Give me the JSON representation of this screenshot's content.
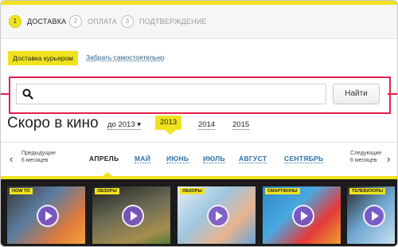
{
  "steps": [
    {
      "num": "1",
      "label": "ДОСТАВКА"
    },
    {
      "num": "2",
      "label": "ОПЛАТА"
    },
    {
      "num": "3",
      "label": "ПОДТВЕРЖДЕНИЕ"
    }
  ],
  "delivery": {
    "courier": "Доставка курьером",
    "pickup": "Забрать самостоятельно"
  },
  "search": {
    "placeholder": "",
    "button": "Найти"
  },
  "soon": {
    "title": "Скоро в кино",
    "dropdown": "до 2013",
    "years": [
      "2013",
      "2014",
      "2015"
    ]
  },
  "months": {
    "prev": [
      "Предыдущие",
      "6 месяцев"
    ],
    "next": [
      "Следующие",
      "6 месяцев"
    ],
    "items": [
      "АПРЕЛЬ",
      "МАЙ",
      "ИЮНЬ",
      "ИЮЛЬ",
      "АВГУСТ",
      "СЕНТЯБРЬ"
    ]
  },
  "cards": [
    {
      "tag": "HOW TO"
    },
    {
      "tag": "ОБЗОРЫ"
    },
    {
      "tag": "ОБЗОРЫ"
    },
    {
      "tag": "СМАРТФОНЫ"
    },
    {
      "tag": "ТЕЛЕВИЗОРЫ"
    }
  ],
  "colors": {
    "accent": "#f0e21f",
    "highlight": "#e3204a",
    "link": "#2a6fa8"
  }
}
